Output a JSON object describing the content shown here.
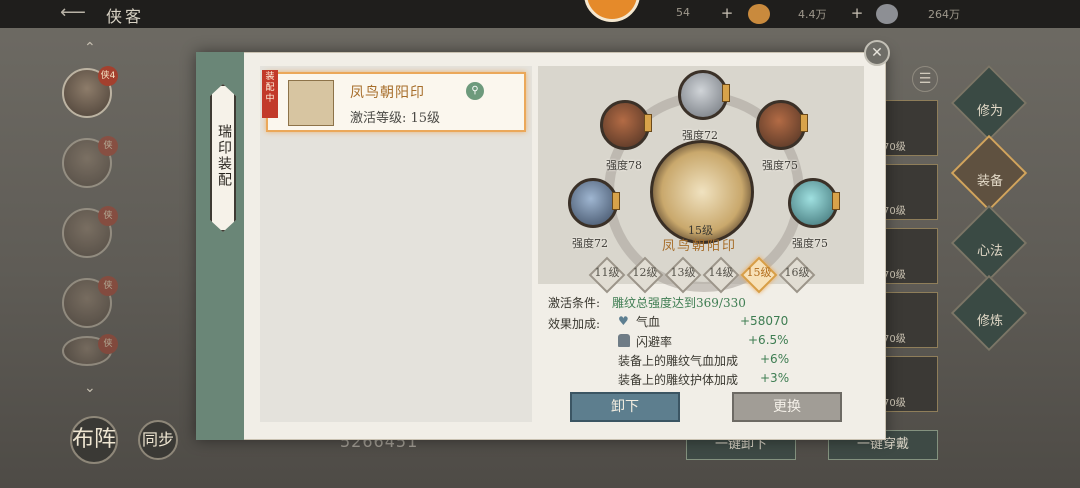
{
  "topbar": {
    "title": "侠客",
    "res1": "54",
    "res2": "4.4万",
    "res3": "264万",
    "res1_plus": "+",
    "res2_plus": "+",
    "back_icon": "back-arrow-icon"
  },
  "heroes": [
    {
      "badge": "侠4"
    },
    {
      "badge": "侠"
    },
    {
      "badge": "侠"
    },
    {
      "badge": "侠"
    },
    {
      "badge": "侠"
    }
  ],
  "bottom_left": {
    "formation": "布阵",
    "sync": "同步"
  },
  "right_tabs": [
    "修为",
    "装备",
    "心法",
    "修炼"
  ],
  "equipment_list": [
    "70级",
    "70级",
    "70级",
    "70级",
    "70级"
  ],
  "bottom_buttons": {
    "unequip_all": "一键卸下",
    "equip_all": "一键穿戴"
  },
  "bg_number": "5266451",
  "dialog": {
    "side_tab": "瑞印装配",
    "equipped_tag": "装配中",
    "seal": {
      "name": "凤鸟朝阳印",
      "level": "激活等级: 15级"
    },
    "center": {
      "level": "15级",
      "name": "凤鸟朝阳印"
    },
    "slots": [
      {
        "label": "强度72"
      },
      {
        "label": "强度78"
      },
      {
        "label": "强度75"
      },
      {
        "label": "强度72"
      },
      {
        "label": "强度75"
      }
    ],
    "levels": [
      "11级",
      "12级",
      "13级",
      "14级",
      "15级",
      "16级"
    ],
    "current_level_index": 4,
    "activation_label": "激活条件:",
    "activation_value": "雕纹总强度达到369/330",
    "effect_label": "效果加成:",
    "effects": [
      {
        "name": "气血",
        "value": "+58070"
      },
      {
        "name": "闪避率",
        "value": "+6.5%"
      },
      {
        "name": "装备上的雕纹气血加成",
        "value": "+6%"
      },
      {
        "name": "装备上的雕纹护体加成",
        "value": "+3%"
      }
    ],
    "buttons": {
      "unequip": "卸下",
      "replace": "更换"
    }
  },
  "colors": {
    "accent_orange": "#eba85a",
    "gold_text": "#a76e2b",
    "green_value": "#3e7d52",
    "unequip_btn": "#5d7e8e",
    "replace_btn": "#a19d96"
  }
}
